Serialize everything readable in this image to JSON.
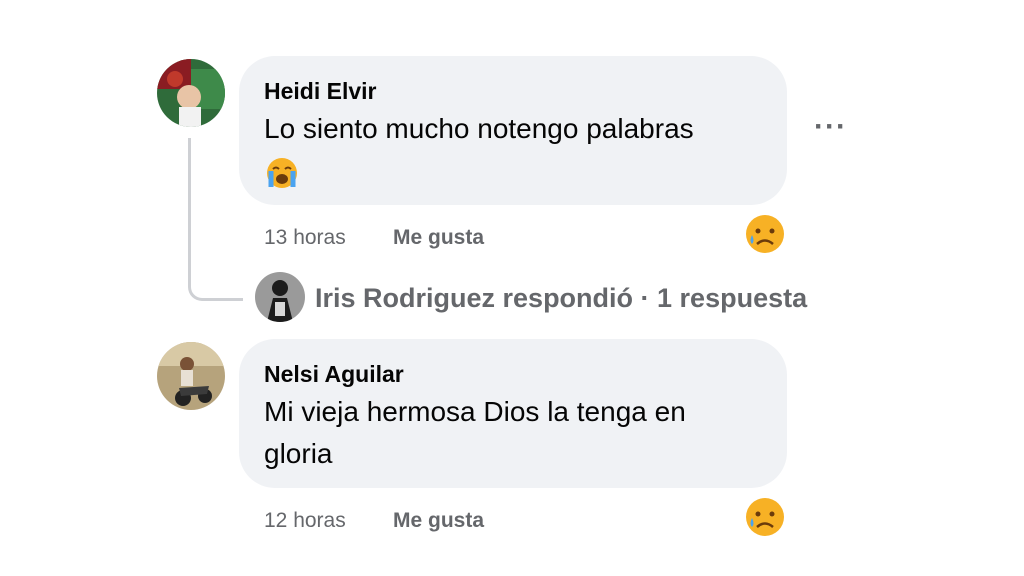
{
  "comments": [
    {
      "author": "Heidi Elvir",
      "text": "Lo siento mucho notengo palabras",
      "time": "13 horas",
      "like_label": "Me gusta",
      "reaction_icon": "crying-face-icon",
      "more_label": "···",
      "inline_emoji": "loudly-crying-face-icon"
    },
    {
      "author": "Nelsi Aguilar",
      "text_line1": "Mi vieja hermosa Dios la tenga en",
      "text_line2": "gloria",
      "time": "12 horas",
      "like_label": "Me gusta",
      "reaction_icon": "crying-face-icon"
    }
  ],
  "replies": {
    "text": "Iris Rodriguez respondió · 1 respuesta"
  },
  "colors": {
    "bubble": "#f0f2f5",
    "meta_text": "#65676b",
    "text": "#050505",
    "emoji_face": "#f7b125"
  }
}
